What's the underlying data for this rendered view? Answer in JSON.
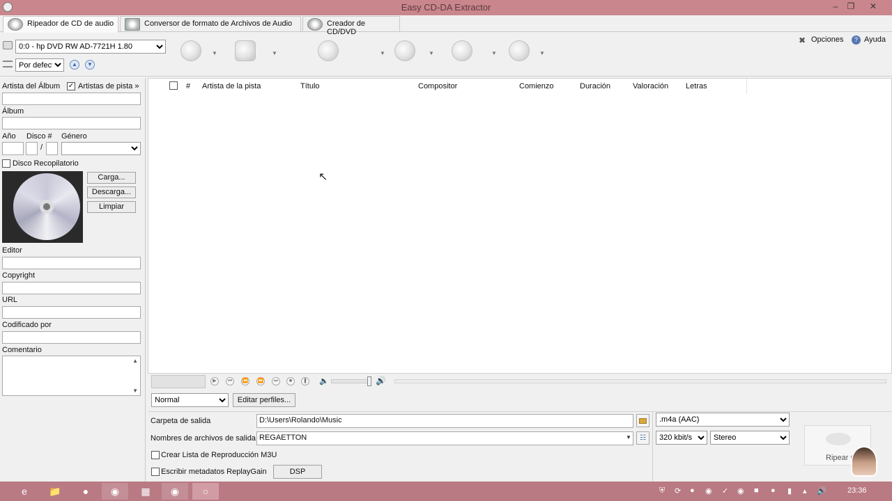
{
  "window": {
    "title": "Easy CD-DA Extractor"
  },
  "tabs": [
    {
      "label": "Ripeador de CD de audio"
    },
    {
      "label": "Conversor de formato de Archivos de Audio"
    },
    {
      "label": "Creador de CD/DVD"
    }
  ],
  "toolbar": {
    "drive": "0:0 - hp DVD RW AD-7721H 1.80",
    "profile": "Por defecto",
    "options_label": "Opciones",
    "help_label": "Ayuda"
  },
  "metadata_panel": {
    "album_artist_label": "Artista del Álbum",
    "track_artists_label": "Artistas de pista »",
    "album_label": "Álbum",
    "year_label": "Año",
    "disc_label": "Disco #",
    "disc_sep": "/",
    "genre_label": "Género",
    "compilation_label": "Disco Recopilatorio",
    "load_button": "Carga...",
    "download_button": "Descarga...",
    "clear_button": "Limpiar",
    "editor_label": "Editor",
    "copyright_label": "Copyright",
    "url_label": "URL",
    "encoded_by_label": "Codificado por",
    "comment_label": "Comentario"
  },
  "tracklist": {
    "columns": [
      "#",
      "Artista de la pista",
      "Título",
      "Compositor",
      "Comienzo",
      "Duración",
      "Valoración",
      "Letras"
    ],
    "rows": []
  },
  "output": {
    "quality_preset": "Normal",
    "edit_profiles_button": "Editar perfiles...",
    "output_folder_label": "Carpeta de salida",
    "output_folder_value": "D:\\Users\\Rolando\\Music",
    "filenames_label": "Nombres de archivos de salida",
    "filenames_value": "REGAETTON",
    "create_playlist_label": "Crear Lista de Reproducción M3U",
    "replaygain_label": "Escribir metadatos ReplayGain",
    "dsp_button": "DSP",
    "format": ".m4a (AAC)",
    "bitrate": "320 kbit/s",
    "channels": "Stereo",
    "rip_button": "Ripear CD"
  },
  "taskbar": {
    "clock": "23:36"
  }
}
